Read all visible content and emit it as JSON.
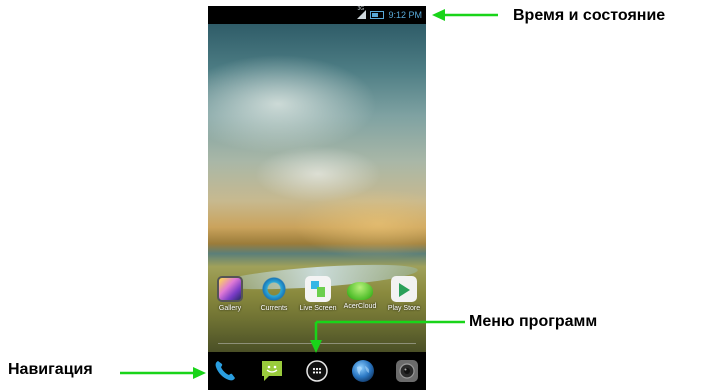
{
  "callouts": {
    "status": "Время и состояние",
    "app_menu": "Меню программ",
    "navigation": "Навигация"
  },
  "status_bar": {
    "time": "9:12 PM",
    "signal_label": "3G"
  },
  "apps": [
    {
      "label": "Gallery",
      "icon": "gallery-icon"
    },
    {
      "label": "Currents",
      "icon": "currents-icon"
    },
    {
      "label": "Live Screen",
      "icon": "live-screen-icon"
    },
    {
      "label": "AcerCloud",
      "icon": "acercloud-icon"
    },
    {
      "label": "Play Store",
      "icon": "play-store-icon"
    }
  ],
  "dock": [
    {
      "icon": "phone-icon"
    },
    {
      "icon": "messaging-icon"
    },
    {
      "icon": "app-drawer-icon"
    },
    {
      "icon": "browser-icon"
    },
    {
      "icon": "camera-icon"
    }
  ],
  "colors": {
    "arrow": "#19d419",
    "status_text": "#58a9d8"
  }
}
